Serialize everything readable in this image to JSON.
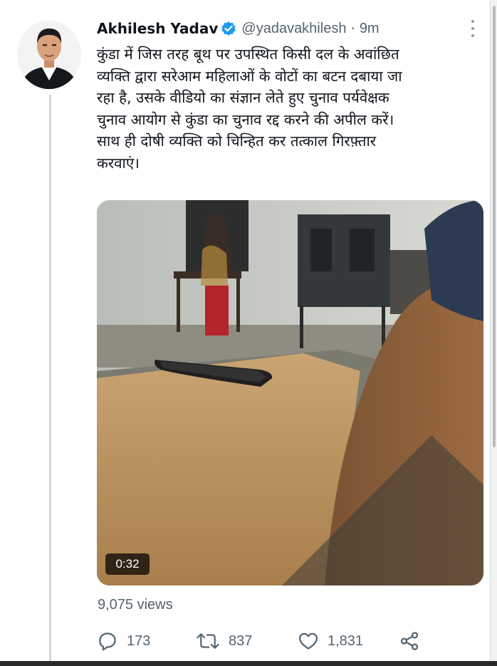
{
  "tweet": {
    "author_name": "Akhilesh Yadav",
    "handle": "@yadavakhilesh",
    "separator": "·",
    "time": "9m",
    "text_lines": [
      "कुंडा में जिस तरह बूथ पर उपस्थित किसी दल के अवांछित",
      "व्यक्ति द्वारा सरेआम महिलाओं के वोटों का बटन दबाया जा",
      "रहा है, उसके वीडियो का संज्ञान लेते हुए चुनाव पर्यवेक्षक",
      "चुनाव आयोग से कुंडा का चुनाव रद्द करने की अपील करें।",
      "साथ ही दोषी व्यक्ति को चिन्हित कर तत्काल गिरफ़्तार",
      "करवाएं।"
    ]
  },
  "media": {
    "duration": "0:32",
    "views": "9,075 views"
  },
  "actions": {
    "replies": "173",
    "retweets": "837",
    "likes": "1,831"
  },
  "icons": {
    "verified": "verified-badge-icon",
    "more": "more-options-icon",
    "reply": "reply-icon",
    "retweet": "retweet-icon",
    "like": "heart-icon",
    "share": "share-icon"
  },
  "colors": {
    "verified_blue": "#1d9bf0",
    "secondary_text": "#536471",
    "thread_line": "#cfd9de"
  }
}
